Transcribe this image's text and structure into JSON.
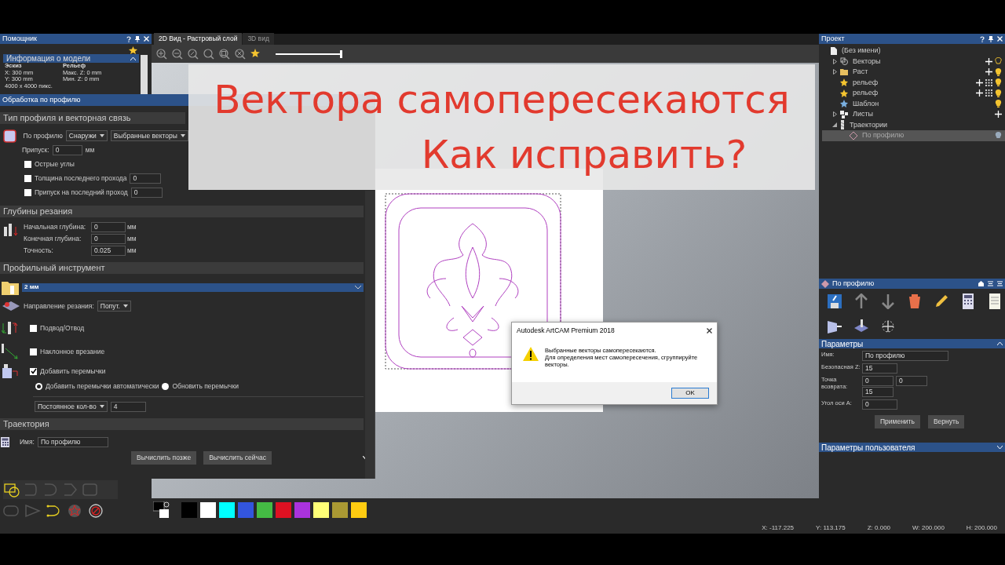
{
  "assistant_panel": {
    "title": "Помощник",
    "info_title": "Информация о модели",
    "sketch_heading": "Эскиз",
    "sketch_lines": [
      "X: 300 mm",
      "Y: 300 mm",
      "4000 x 4000 пикс."
    ],
    "relief_heading": "Рельеф",
    "relief_lines": [
      "Макс. Z: 0 mm",
      "Мин. Z: 0 mm"
    ]
  },
  "view_tabs": [
    {
      "label": "2D Вид - Растровый слой",
      "selected": true
    },
    {
      "label": "3D вид",
      "selected": false
    }
  ],
  "zoom_slider": {
    "level": 1.0
  },
  "profile_window": {
    "title": "Обработка по профилю",
    "type_section": {
      "heading": "Тип профиля и векторная связь",
      "profile_label": "По профилю",
      "side": "Снаружи",
      "vectors": "Выбранные векторы",
      "allowance_label": "Припуск:",
      "allowance": "0",
      "allowance_unit": "мм",
      "options": [
        {
          "label": "Острые углы",
          "checked": false
        },
        {
          "label": "Толщина последнего прохода",
          "checked": false,
          "value": "0"
        },
        {
          "label": "Припуск на последний проход",
          "checked": false,
          "value": "0"
        }
      ]
    },
    "depth_section": {
      "heading": "Глубины резания",
      "fields": [
        {
          "label": "Начальная глубина:",
          "value": "0",
          "unit": "мм"
        },
        {
          "label": "Конечная глубина:",
          "value": "0",
          "unit": "мм"
        },
        {
          "label": "Точность:",
          "value": "0.025",
          "unit": "мм"
        }
      ]
    },
    "tool_section": {
      "heading": "Профильный инструмент",
      "tool_name": "2 мм",
      "direction_label": "Направление резания:",
      "direction": "Попут.",
      "options": [
        {
          "kind": "leadin",
          "label": "Подвод/Отвод",
          "checked": false
        },
        {
          "kind": "ramp",
          "label": "Наклонное врезание",
          "checked": false
        },
        {
          "kind": "bridges",
          "label": "Добавить перемычки",
          "checked": true
        }
      ],
      "bridge_modes": [
        {
          "label": "Добавить перемычки автоматически",
          "selected": true
        },
        {
          "label": "Обновить перемычки",
          "selected": false
        }
      ],
      "bridge_count_mode": "Постоянное кол-во",
      "bridge_count": "4"
    },
    "toolpath_section": {
      "heading": "Траектория",
      "name_label": "Имя:",
      "name": "По профилю",
      "buttons": [
        "Вычислить позже",
        "Вычислить сейчас"
      ]
    }
  },
  "palette": {
    "colors": [
      {
        "color": "#000000"
      },
      {
        "color": "#ffffff"
      },
      {
        "color": "#00ffff"
      },
      {
        "color": "#3355dd"
      },
      {
        "color": "#44bb44"
      },
      {
        "color": "#dd1122"
      },
      {
        "color": "#aa33dd"
      },
      {
        "color": "#ffff77"
      },
      {
        "color": "#aa9933"
      },
      {
        "color": "#ffcc11"
      }
    ]
  },
  "project_panel": {
    "title": "Проект",
    "tree": [
      {
        "kind": "model",
        "label": "(Без имени)",
        "selected": false,
        "children": [
          {
            "kind": "vectors",
            "label": "Векторы",
            "selected": false,
            "expanded": false
          },
          {
            "kind": "raster",
            "label": "Раст",
            "selected": false,
            "expanded": false
          },
          {
            "kind": "relief",
            "label": "рельеф",
            "selected": false
          },
          {
            "kind": "relief",
            "label": "рельеф",
            "selected": false
          },
          {
            "kind": "template",
            "label": "Шаблон",
            "selected": false
          },
          {
            "kind": "sheets",
            "label": "Листы",
            "selected": false,
            "expanded": false
          },
          {
            "kind": "toolpaths",
            "label": "Траектории",
            "selected": false,
            "expanded": true,
            "children": [
              {
                "kind": "toolpath",
                "label": "По профилю",
                "selected": true
              }
            ]
          }
        ]
      }
    ]
  },
  "toolpath_panel": {
    "title": "По профилю",
    "params_heading": "Параметры",
    "name_label": "Имя:",
    "name": "По профилю",
    "safe_z_label": "Безопасная Z:",
    "safe_z": "15",
    "home_label": "Точка возврата:",
    "home": [
      "0",
      "0",
      "15"
    ],
    "angle_label": "Угол оси A:",
    "angle": "0",
    "buttons": [
      "Применить",
      "Вернуть"
    ],
    "user_params_heading": "Параметры пользователя"
  },
  "dialog": {
    "title": "Autodesk ArtCAM Premium 2018",
    "message": [
      "Выбранные векторы самопересекаются.",
      "Для определения мест самопересечения, сгруппируйте векторы."
    ],
    "button": "OK"
  },
  "status_bar": [
    "X: -117.225",
    "Y: 113.175",
    "Z: 0.000",
    "W: 200.000",
    "H: 200.000"
  ],
  "banner": {
    "lines": [
      "Вектора самопересекаются",
      "Как исправить?"
    ]
  }
}
